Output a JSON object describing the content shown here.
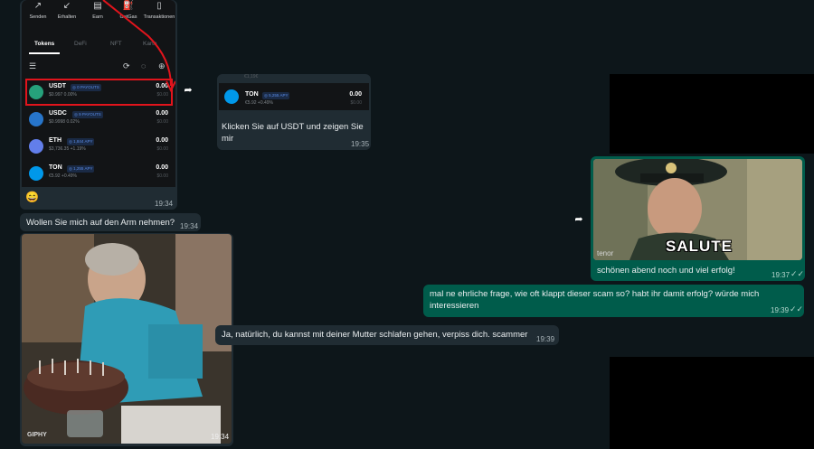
{
  "wallet": {
    "actions": [
      "Senden",
      "Erhalten",
      "Earn",
      "GetGas",
      "Transaktionen"
    ],
    "tabs": [
      "Tokens",
      "DeFi",
      "NFT",
      "Karte"
    ],
    "tokens": [
      {
        "name": "USDT",
        "badge": "◎ 0 PAYOUTS",
        "sub": "$0.997 0.00%",
        "value": "0.00",
        "value2": "$0.00",
        "color": "#26a17b"
      },
      {
        "name": "USDC",
        "badge": "◎ 9 PAYOUTS",
        "sub": "$0.9998 0.02%",
        "value": "0.00",
        "value2": "$0.00",
        "color": "#2775ca"
      },
      {
        "name": "ETH",
        "badge": "◎ 1,844 APY",
        "sub": "$3,736.35 +1.19%",
        "value": "0.00",
        "value2": "$0.00",
        "color": "#627eea"
      },
      {
        "name": "TON",
        "badge": "◎ 1,255 APY",
        "sub": "€5.92 +0.49%",
        "value": "0.00",
        "value2": "$0.00",
        "color": "#0098ea"
      }
    ],
    "emoji": "😄",
    "time": "19:34"
  },
  "msg_wollen": {
    "text": "Wollen Sie mich auf den Arm nehmen?",
    "time": "19:34"
  },
  "gif_birthday": {
    "watermark": "GIPHY",
    "time": "19:34"
  },
  "msg_klicken": {
    "partial_top": "€1,19€",
    "token_name": "TON",
    "token_badge": "◎ 5,255 APY",
    "token_sub": "€5.92 +0.49%",
    "token_value": "0.00",
    "token_value2": "$0.00",
    "text": "Klicken Sie auf USDT und zeigen Sie mir",
    "time": "19:35"
  },
  "msg_ja": {
    "text": "Ja, natürlich, du kannst mit deiner Mutter schlafen gehen, verpiss dich. scammer",
    "time": "19:39"
  },
  "msg_salute": {
    "gif_caption": "SALUTE",
    "gif_source": "tenor",
    "text": "schönen abend noch und viel erfolg!",
    "time": "19:37"
  },
  "msg_frage": {
    "text_line1": "mal ne ehrliche frage, wie oft klappt dieser scam so? habt ihr damit erfolg? würde mich",
    "text_line2": "interessieren",
    "time": "19:39"
  },
  "colors": {
    "incoming": "#202c33",
    "outgoing": "#005c4b",
    "highlight": "#e1141c",
    "read_ticks": "#53bdeb"
  }
}
